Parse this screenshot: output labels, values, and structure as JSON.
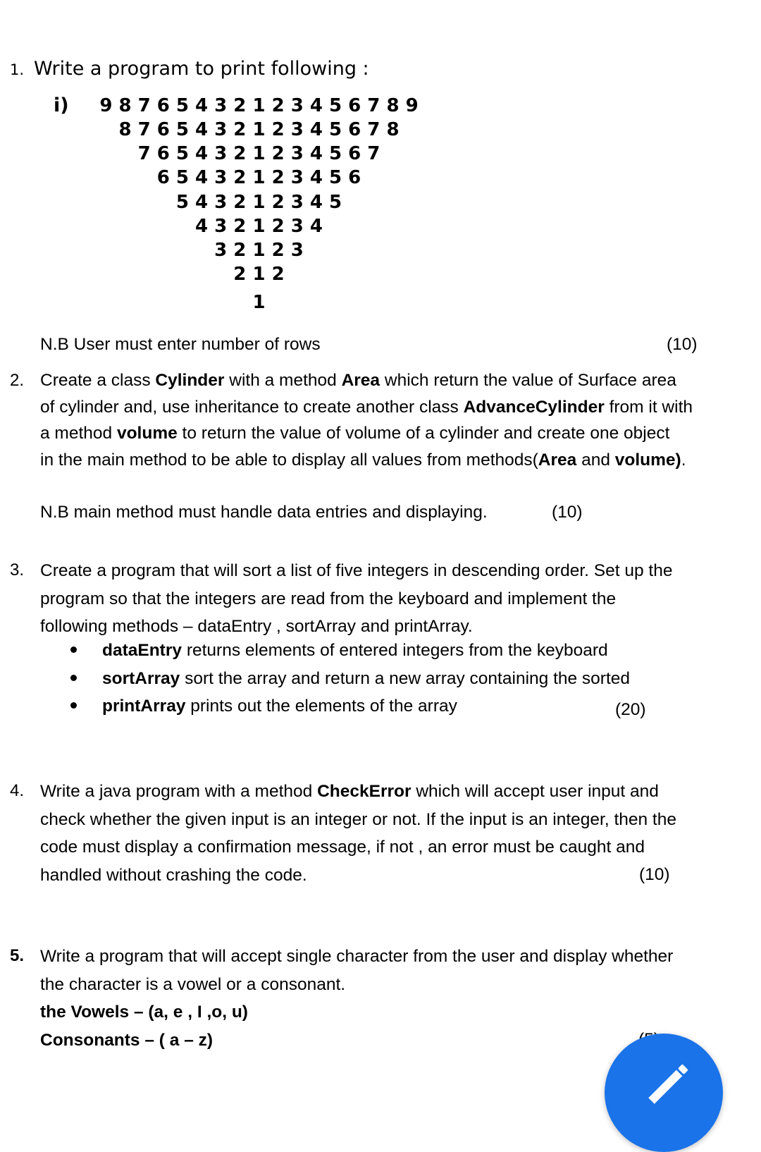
{
  "q1": {
    "number": "1.",
    "title": "Write a program to print following :",
    "sub_label": "i)",
    "pattern_rows": [
      "9 8 7 6 5 4 3 2 1 2 3 4 5 6 7 8 9",
      "8 7 6 5 4 3 2 1 2 3 4 5 6 7 8",
      "7 6 5 4 3 2 1 2 3 4 5 6 7",
      "6 5 4 3 2 1 2 3 4 5 6",
      "5 4 3 2 1 2 3 4 5",
      "4 3 2 1 2 3 4",
      "3 2 1 2 3",
      "2 1 2",
      "1"
    ],
    "note": "N.B User must  enter number of rows",
    "marks": "(10)"
  },
  "q2": {
    "number": "2.",
    "lines": [
      [
        {
          "t": "Create a class "
        },
        {
          "t": "Cylinder",
          "b": true
        },
        {
          "t": " with  a method "
        },
        {
          "t": "Area",
          "b": true
        },
        {
          "t": " which return the value of Surface area"
        }
      ],
      [
        {
          "t": "of cylinder and, use inheritance to create another class "
        },
        {
          "t": "AdvanceCylinder",
          "b": true
        },
        {
          "t": " from it with"
        }
      ],
      [
        {
          "t": "a method "
        },
        {
          "t": "volume",
          "b": true
        },
        {
          "t": " to return the value of volume of a cylinder and create one object"
        }
      ],
      [
        {
          "t": "in the main method to be able to display all values from methods("
        },
        {
          "t": "Area",
          "b": true
        },
        {
          "t": " and "
        },
        {
          "t": "volume)",
          "b": true
        },
        {
          "t": "."
        }
      ]
    ],
    "note": "N.B main method must handle data entries and displaying.",
    "marks": "(10)"
  },
  "q3": {
    "number": "3.",
    "lines": [
      "Create a program that will sort a list of five integers in descending order. Set up the",
      "program so that the integers are read from the keyboard and implement the",
      "following methods – dataEntry , sortArray and printArray."
    ],
    "bullets": [
      {
        "term": "dataEntry",
        "text": " returns elements of entered integers from the keyboard"
      },
      {
        "term": "sortArray",
        "text": " sort the array and return a new array containing the sorted"
      },
      {
        "term": "printArray",
        "text": " prints out the elements of the array"
      }
    ],
    "marks": "(20)"
  },
  "q4": {
    "number": "4.",
    "lines": [
      [
        {
          "t": "Write a java program with a method "
        },
        {
          "t": "CheckError",
          "b": true
        },
        {
          "t": " which will accept user input and"
        }
      ],
      [
        {
          "t": "check whether the given input is an integer or not. If the input is an integer, then the"
        }
      ],
      [
        {
          "t": "code must display a confirmation message, if not , an error must be caught and"
        }
      ],
      [
        {
          "t": "handled without crashing the code."
        }
      ]
    ],
    "marks": "(10)"
  },
  "q5": {
    "number": "5.",
    "lines": [
      "Write a program that will accept single character from the user and display whether",
      "the character is a vowel or a consonant."
    ],
    "vowels": "the Vowels – (a, e , I ,o, u)",
    "consonants": "Consonants – ( a – z)",
    "marks": "(5)"
  },
  "fab": {
    "icon": "pencil-edit-icon",
    "color": "#1a73e8"
  }
}
